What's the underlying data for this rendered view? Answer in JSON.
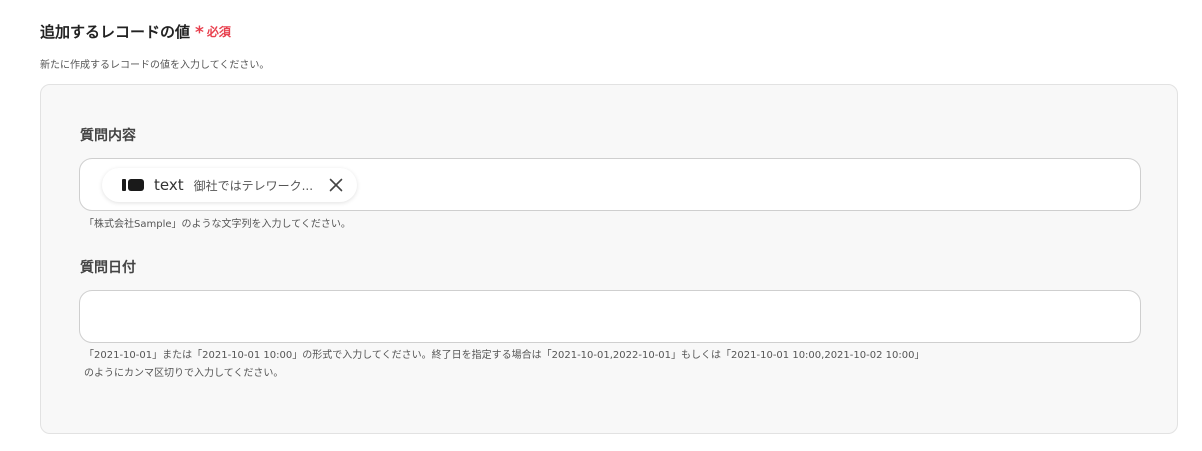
{
  "section": {
    "title": "追加するレコードの値",
    "required_mark": "*",
    "required_text": "必須",
    "description": "新たに作成するレコードの値を入力してください。"
  },
  "fields": [
    {
      "label": "質問内容",
      "chip": {
        "icon": "block-icon",
        "type": "text",
        "value": "御社ではテレワーク..."
      },
      "hint": "「株式会社Sample」のような文字列を入力してください。"
    },
    {
      "label": "質問日付",
      "value": "",
      "hint_line1": "「2021-10-01」または「2021-10-01 10:00」の形式で入力してください。終了日を指定する場合は「2021-10-01,2022-10-01」もしくは「2021-10-01 10:00,2021-10-02 10:00」",
      "hint_line2": "のようにカンマ区切りで入力してください。"
    }
  ],
  "colors": {
    "required": "#e8414f",
    "panel_bg": "#f8f8f8",
    "panel_border": "#e2e2e2",
    "input_border": "#cfcfcf"
  }
}
